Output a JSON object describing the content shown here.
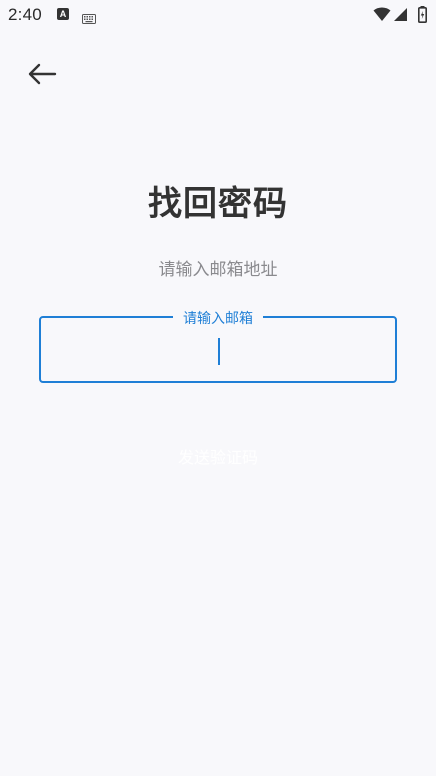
{
  "status_bar": {
    "time": "2:40",
    "icons": [
      "a-notification-icon",
      "keyboard-icon",
      "wifi-icon",
      "signal-icon",
      "battery-icon"
    ]
  },
  "header": {
    "back_icon": "arrow-left-icon"
  },
  "main": {
    "title": "找回密码",
    "subtitle": "请输入邮箱地址",
    "email_field": {
      "label": "请输入邮箱",
      "value": ""
    },
    "send_button_label": "发送验证码"
  },
  "colors": {
    "background": "#f8f8fb",
    "accent": "#1f7fd6",
    "title": "#333333",
    "subtitle": "#8a8a8e"
  }
}
